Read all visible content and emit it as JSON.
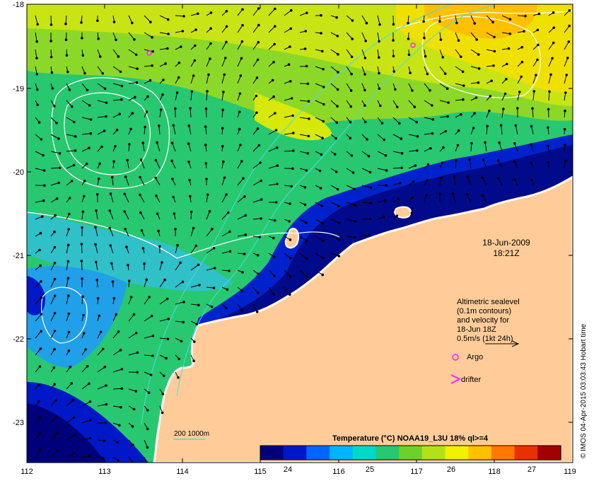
{
  "axes": {
    "x_ticks": [
      "112",
      "113",
      "114",
      "115",
      "116",
      "117",
      "118",
      "119"
    ],
    "y_ticks": [
      "-18",
      "-19",
      "-20",
      "-21",
      "-22",
      "-23"
    ]
  },
  "timestamp": {
    "date": "18-Jun-2009",
    "time": "18:21Z"
  },
  "legend_text": {
    "line1": "Altimetric sealevel",
    "line2": "(0.1m contours)",
    "line3": "and velocity for",
    "line4": "18-Jun 18Z",
    "line5": "0.5m/s (1kt 24h)"
  },
  "markers": {
    "argo_label": "Argo",
    "drifter_label": "drifter"
  },
  "isobath_label": "200  1000m",
  "colorbar": {
    "title": "Temperature (°C) NOAA19_L3U 18% ql>=4",
    "ticks": [
      "24",
      "25",
      "26",
      "27"
    ],
    "colors": [
      "#00007a",
      "#0018c8",
      "#0066ff",
      "#00b4ff",
      "#00d8c8",
      "#28c870",
      "#6cd22a",
      "#b4e018",
      "#f0f000",
      "#ffc000",
      "#ff7800",
      "#e83000",
      "#a00000"
    ]
  },
  "credit": "© IMOS 04-Apr-2015 03:03:43 Hobart time"
}
